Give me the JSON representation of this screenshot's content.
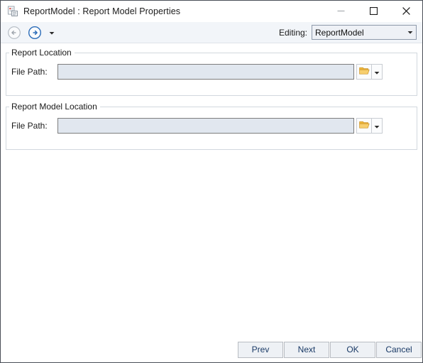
{
  "window": {
    "title": "ReportModel : Report Model Properties",
    "icon": "report-properties-icon",
    "controls": {
      "minimize": "minimize-icon",
      "maximize": "maximize-icon",
      "close": "close-icon"
    }
  },
  "toolbar": {
    "back": "back-arrow-icon",
    "forward": "forward-arrow-icon",
    "dropdown": "chevron-down-icon",
    "editing_label": "Editing:",
    "editing_value": "ReportModel",
    "combo_arrow": "chevron-down-icon"
  },
  "groups": [
    {
      "legend": "Report Location",
      "field_label": "File Path:",
      "field_value": "",
      "field_placeholder": "",
      "browse_icon": "open-folder-icon",
      "browse_arrow": "chevron-down-icon"
    },
    {
      "legend": "Report Model Location",
      "field_label": "File Path:",
      "field_value": "",
      "field_placeholder": "",
      "browse_icon": "open-folder-icon",
      "browse_arrow": "chevron-down-icon"
    }
  ],
  "footer": {
    "prev": "Prev",
    "next": "Next",
    "ok": "OK",
    "cancel": "Cancel"
  },
  "colors": {
    "titlebar_bg": "#ffffff",
    "toolbar_bg": "#f2f5f9",
    "body_bg": "#ffffff",
    "group_border": "#d2d8de",
    "input_bg": "#e1e7ef",
    "input_border": "#7d7d7d",
    "button_bg": "#eef1f5",
    "button_text": "#1a3a66",
    "accent_blue": "#2b6cb8",
    "folder_yellow": "#f2c14e"
  }
}
